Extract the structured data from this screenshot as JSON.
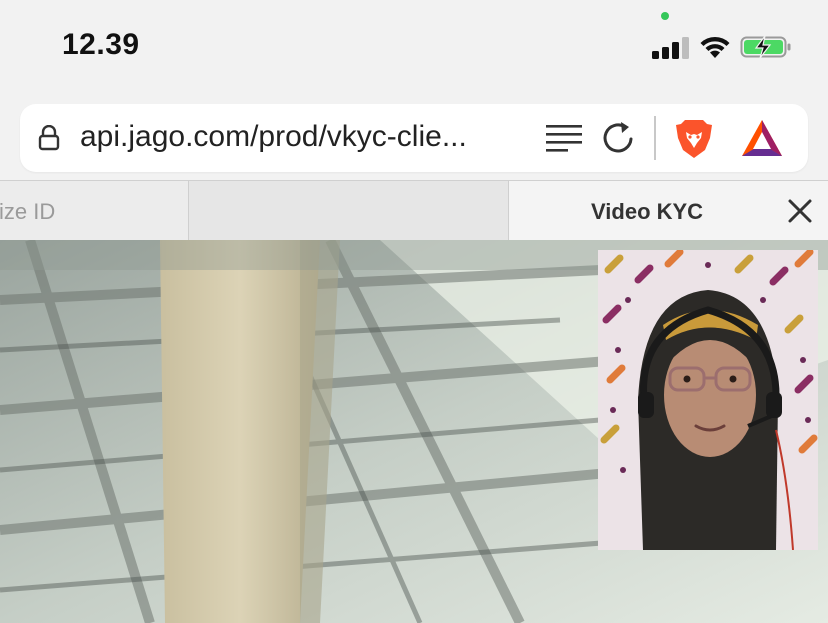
{
  "status_bar": {
    "time": "12.39"
  },
  "browser": {
    "url": "api.jago.com/prod/vkyc-clie...",
    "icons": [
      "lock-icon",
      "reader-mode-icon",
      "reload-icon",
      "brave-shields-icon",
      "brave-rewards-icon"
    ]
  },
  "tabs": [
    {
      "label": "itize ID"
    },
    {
      "label": ""
    },
    {
      "label": "Video KYC"
    }
  ],
  "colors": {
    "status_green": "#34c759",
    "battery_green": "#4cd964",
    "brave_orange": "#fb542b"
  }
}
